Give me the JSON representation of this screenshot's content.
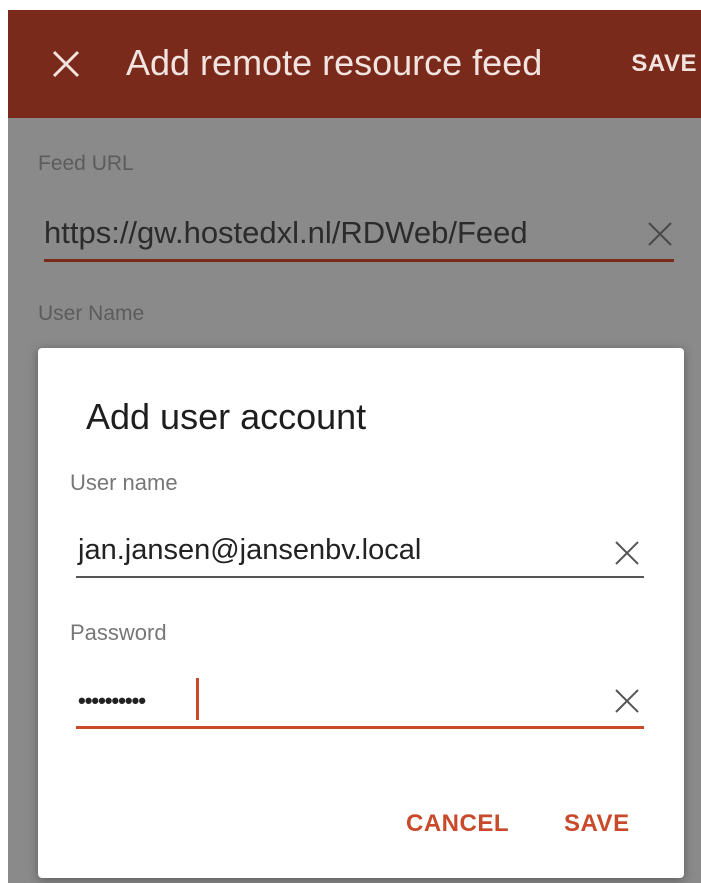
{
  "appbar": {
    "title": "Add remote resource feed",
    "save_label": "SAVE"
  },
  "form": {
    "feed_url_label": "Feed URL",
    "feed_url_value": "https://gw.hostedxl.nl/RDWeb/Feed",
    "username_label": "User Name"
  },
  "dialog": {
    "title": "Add user account",
    "username_label": "User name",
    "username_value": "jan.jansen@jansenbv.local",
    "password_label": "Password",
    "password_mask": "••••••••••",
    "cancel_label": "CANCEL",
    "save_label": "SAVE"
  },
  "colors": {
    "appbar": "#7a2a1a",
    "accent": "#c84a2b",
    "scrim": "#8a8a8a"
  },
  "icons": {
    "close": "close-icon",
    "clear": "clear-icon"
  }
}
